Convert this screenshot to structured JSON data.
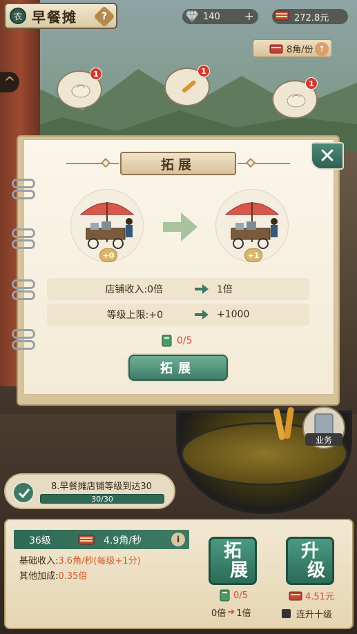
{
  "header": {
    "seal_char": "农",
    "stall_name": "早餐摊",
    "help_label": "?",
    "gems": "140",
    "gems_plus": "+",
    "money": "272.8元",
    "price_per_item": "8角/份",
    "price_up": "↑"
  },
  "bubbles": [
    {
      "badge": "1",
      "food": "bun"
    },
    {
      "badge": "1",
      "food": "fried-dough-stick"
    },
    {
      "badge": "1",
      "food": "bun"
    }
  ],
  "side_button": {
    "label": "^"
  },
  "dialog": {
    "title": "拓展",
    "close_label": "✕",
    "from_level_tag": "+0",
    "to_level_tag": "+1",
    "rows": [
      {
        "label": "店铺收入:0倍",
        "to": "1倍"
      },
      {
        "label": "等级上限:+0",
        "to": "+1000"
      }
    ],
    "cost": "0/5",
    "confirm_label": "拓展"
  },
  "task": {
    "text": "8.早餐摊店铺等级到达30",
    "progress_text": "30/30",
    "progress": 1.0
  },
  "side_work_button": {
    "label": "业务"
  },
  "panel": {
    "level": "36级",
    "income_rate": "4.9角/秒",
    "info_label": "i",
    "base_income_label": "基础收入:",
    "base_income_value": "3.6角/秒(每级+1分)",
    "other_bonus_label": "其他加成:",
    "other_bonus_value": "0.35倍",
    "expand_btn": {
      "char1": "拓",
      "char2": "展",
      "cost": "0/5",
      "effect_from": "0倍",
      "effect_to": "1倍"
    },
    "upgrade_btn": {
      "char1": "升",
      "char2": "级",
      "cost": "4.51元"
    },
    "multi_upgrade_label": "连升十级"
  },
  "colors": {
    "accent_green": "#3e7a63",
    "paper": "#f3ebd7",
    "cost_red": "#d04a3a"
  }
}
